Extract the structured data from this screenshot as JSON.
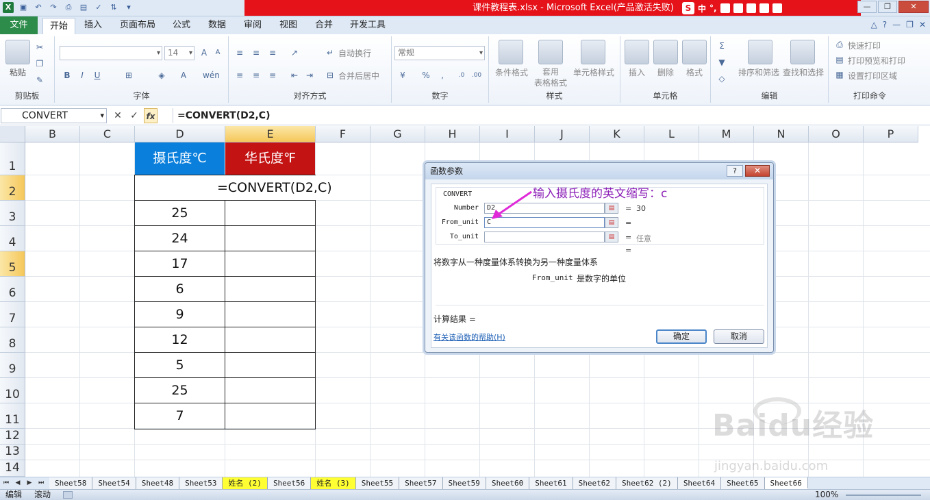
{
  "window": {
    "title": "课件教程表.xlsx - Microsoft Excel(产品激活失败)",
    "ime": {
      "label": "中",
      "punct": "°,"
    }
  },
  "ribbon": {
    "tabs": [
      "文件",
      "开始",
      "插入",
      "页面布局",
      "公式",
      "数据",
      "审阅",
      "视图",
      "合并",
      "开发工具"
    ],
    "active_tab": "开始",
    "groups": {
      "clipboard": {
        "label": "剪贴板",
        "paste": "粘贴"
      },
      "font": {
        "label": "字体",
        "size": "14",
        "bold": "B",
        "italic": "I",
        "underline": "U"
      },
      "align": {
        "label": "对齐方式",
        "wrap": "自动换行",
        "merge": "合并后居中"
      },
      "number": {
        "label": "数字",
        "format": "常规"
      },
      "styles": {
        "label": "样式",
        "cond": "条件格式",
        "table": "套用\n表格格式",
        "cell": "单元格样式"
      },
      "cells": {
        "label": "单元格",
        "insert": "插入",
        "delete": "删除",
        "format": "格式"
      },
      "edit": {
        "label": "编辑",
        "sort": "排序和筛选",
        "find": "查找和选择"
      },
      "print": {
        "label": "打印命令",
        "quick": "快速打印",
        "preview": "打印预览和打印",
        "area": "设置打印区域"
      }
    }
  },
  "formula_bar": {
    "name_box": "CONVERT",
    "formula": "=CONVERT(D2,C)",
    "cancel": "✕",
    "enter": "✓",
    "fx": "fx"
  },
  "grid": {
    "columns": [
      "B",
      "C",
      "D",
      "E",
      "F",
      "G",
      "H",
      "I",
      "J",
      "K",
      "L",
      "M",
      "N",
      "O",
      "P"
    ],
    "rows": [
      "1",
      "2",
      "3",
      "4",
      "5",
      "6",
      "7",
      "8",
      "9",
      "10",
      "11",
      "12",
      "13",
      "14"
    ],
    "header_d": "摄氏度℃",
    "header_e": "华氏度℉",
    "edit_text": "=CONVERT(D2,C)",
    "values": [
      "25",
      "24",
      "17",
      "6",
      "9",
      "12",
      "5",
      "25",
      "7"
    ]
  },
  "dialog": {
    "title": "函数参数",
    "help_btn": "?",
    "close_btn": "✕",
    "function_name": "CONVERT",
    "args": [
      {
        "label": "Number",
        "value": "D2",
        "result": "30"
      },
      {
        "label": "From_unit",
        "value": "C",
        "result": ""
      },
      {
        "label": "To_unit",
        "value": "",
        "result": "任意"
      }
    ],
    "eq": "=",
    "description": "将数字从一种度量体系转换为另一种度量体系",
    "param_desc_name": "From_unit",
    "param_desc": "是数字的单位",
    "result_label": "计算结果 =",
    "help_link": "有关该函数的帮助(H)",
    "ok": "确定",
    "cancel": "取消"
  },
  "annotation": "输入摄氏度的英文缩写：c",
  "sheets": [
    "Sheet58",
    "Sheet54",
    "Sheet48",
    "Sheet53",
    "姓名 (2)",
    "Sheet56",
    "姓名 (3)",
    "Sheet55",
    "Sheet57",
    "Sheet59",
    "Sheet60",
    "Sheet61",
    "Sheet62",
    "Sheet62 (2)",
    "Sheet64",
    "Sheet65",
    "Sheet66"
  ],
  "status": {
    "mode": "编辑",
    "scroll": "滚动",
    "zoom": "100%"
  },
  "watermark": {
    "brand": "Baidu经验",
    "url": "jingyan.baidu.com"
  }
}
